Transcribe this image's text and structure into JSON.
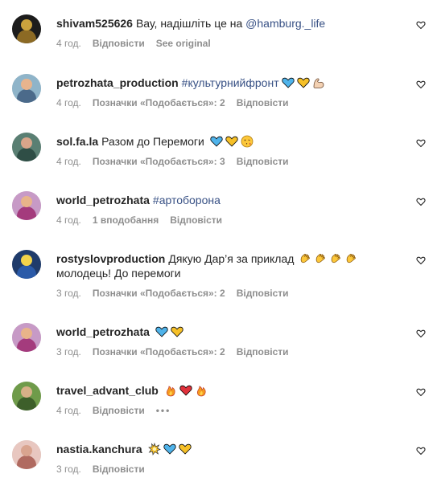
{
  "comments": [
    {
      "username": "shivam525626",
      "text": "Вау, надішліть це на",
      "mention": "@hamburg._life",
      "time": "4 год.",
      "reply": "Відповісти",
      "extra": "See original",
      "avatar": {
        "bg": "#1c1c1c",
        "fig": "#caa23d",
        "body": "#8c6a24"
      }
    },
    {
      "username": "petrozhata_production",
      "hashtag": "#культурнийфронт",
      "emoji": [
        "blue-heart",
        "yellow-heart",
        "flexed-biceps"
      ],
      "time": "4 год.",
      "likes": "Позначки «Подобається»: 2",
      "reply": "Відповісти",
      "avatar": {
        "bg": "#8fb4c9",
        "fig": "#e7b48e",
        "body": "#4b6a8a"
      }
    },
    {
      "username": "sol.fa.la",
      "text": "Разом до Перемоги",
      "emoji": [
        "blue-heart",
        "yellow-heart",
        "face-blowing-kiss"
      ],
      "time": "4 год.",
      "likes": "Позначки «Подобається»: 3",
      "reply": "Відповісти",
      "avatar": {
        "bg": "#5a7f73",
        "fig": "#d9a58a",
        "body": "#2f4e46"
      }
    },
    {
      "username": "world_petrozhata",
      "hashtag": "#артоборона",
      "time": "4 год.",
      "likes": "1 вподобання",
      "reply": "Відповісти",
      "avatar": {
        "bg": "#c79ac6",
        "fig": "#e8b48a",
        "body": "#a43b7d"
      }
    },
    {
      "username": "rostyslovproduction",
      "text": "Дякую Дар’я за приклад",
      "emoji": [
        "clapping-hands",
        "clapping-hands",
        "clapping-hands",
        "clapping-hands"
      ],
      "text2": "молодець! До перемоги",
      "time": "3 год.",
      "likes": "Позначки «Подобається»: 2",
      "reply": "Відповісти",
      "avatar": {
        "bg": "#1f3b6b",
        "fig": "#f2d24a",
        "body": "#2a5aa8"
      }
    },
    {
      "username": "world_petrozhata",
      "emoji": [
        "blue-heart",
        "yellow-heart"
      ],
      "time": "3 год.",
      "likes": "Позначки «Подобається»: 2",
      "reply": "Відповісти",
      "avatar": {
        "bg": "#c79ac6",
        "fig": "#e8b48a",
        "body": "#a43b7d"
      }
    },
    {
      "username": "travel_advant_club",
      "emoji": [
        "fire",
        "red-heart",
        "fire"
      ],
      "time": "4 год.",
      "reply": "Відповісти",
      "more": "•••",
      "avatar": {
        "bg": "#6f9b4a",
        "fig": "#d7b087",
        "body": "#3d5f2a"
      }
    },
    {
      "username": "nastia.kanchura",
      "emoji": [
        "collision",
        "blue-heart",
        "yellow-heart"
      ],
      "time": "3 год.",
      "reply": "Відповісти",
      "avatar": {
        "bg": "#e8c7c0",
        "fig": "#d9a48f",
        "body": "#b06a60"
      }
    }
  ],
  "colors": {
    "text": "#262626",
    "meta": "#8e8e8e",
    "link": "#385185",
    "blueHeart": "#4fb3ea",
    "yellowHeart": "#f6c028",
    "redHeart": "#e0313b",
    "fire": "#f59a1f"
  }
}
